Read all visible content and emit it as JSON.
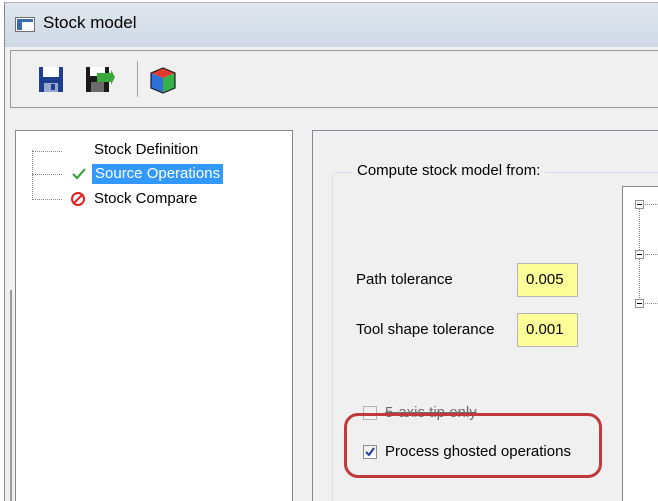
{
  "window": {
    "title": "Stock model"
  },
  "toolbar": {
    "buttons": [
      {
        "icon": "save-icon"
      },
      {
        "icon": "save-and-exit-icon"
      },
      {
        "icon": "stock-model-cube-icon"
      }
    ]
  },
  "tree": {
    "items": [
      {
        "label": "Stock Definition",
        "status": "none",
        "selected": false
      },
      {
        "label": "Source Operations",
        "status": "check",
        "selected": true
      },
      {
        "label": "Stock Compare",
        "status": "error",
        "selected": false
      }
    ]
  },
  "main": {
    "group_title": "Compute stock model from:",
    "path_tolerance": {
      "label": "Path tolerance",
      "value": "0.005"
    },
    "tool_shape_tolerance": {
      "label": "Tool shape tolerance",
      "value": "0.001"
    },
    "five_axis_tip_only": {
      "label": "5-axis tip only",
      "checked": false
    },
    "process_ghosted": {
      "label": "Process ghosted operations",
      "checked": true
    }
  },
  "colors": {
    "selection": "#3399ff",
    "field_bg": "#ffff99",
    "highlight": "#c0393b",
    "check": "#2e9e2e",
    "error": "#e02020"
  }
}
